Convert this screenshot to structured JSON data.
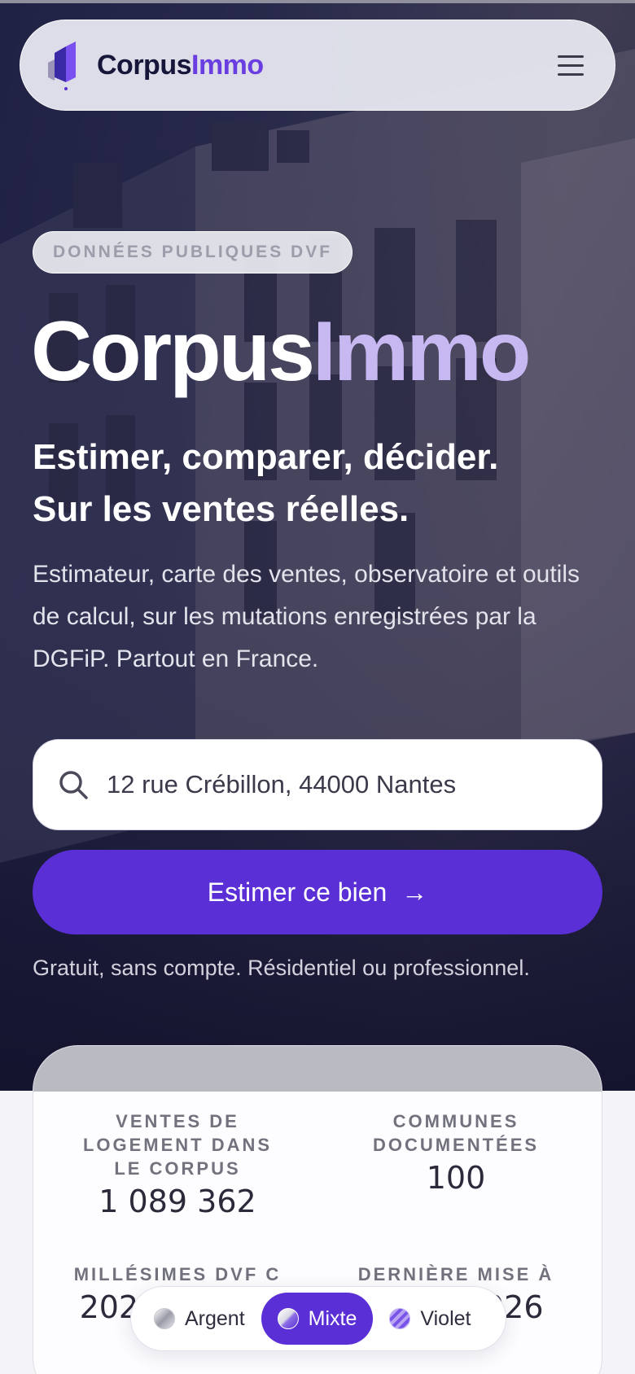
{
  "header": {
    "logo_text_main": "Corpus",
    "logo_text_accent": "Immo"
  },
  "hero": {
    "badge": "DONNÉES PUBLIQUES DVF",
    "title_main": "Corpus",
    "title_accent": "Immo",
    "subtitle_line1": "Estimer, comparer, décider.",
    "subtitle_line2": "Sur les ventes réelles.",
    "description": "Estimateur, carte des ventes, observatoire et outils de calcul, sur les mutations enregistrées par la DGFiP. Partout en France.",
    "search_value": "12 rue Crébillon, 44000 Nantes",
    "cta_label": "Estimer ce bien",
    "note": "Gratuit, sans compte. Résidentiel ou professionnel."
  },
  "stats": {
    "items": [
      {
        "label": "VENTES DE LOGEMENT DANS LE CORPUS",
        "value": "1 089 362"
      },
      {
        "label": "COMMUNES DOCUMENTÉES",
        "value": "100"
      },
      {
        "label": "MILLÉSIMES DVF C",
        "value": "2022 à 2025"
      },
      {
        "label": "DERNIÈRE MISE À",
        "value": "2 avr. 2026"
      }
    ]
  },
  "theme_switcher": {
    "options": [
      {
        "label": "Argent",
        "icon": "silver-dot-icon"
      },
      {
        "label": "Mixte",
        "icon": "mixed-dot-icon"
      },
      {
        "label": "Violet",
        "icon": "violet-dot-icon"
      }
    ],
    "selected": "Mixte"
  },
  "colors": {
    "accent": "#5b2fd6",
    "accent_light": "#c8b8f2",
    "hero_dark": "#1a1a3e"
  }
}
